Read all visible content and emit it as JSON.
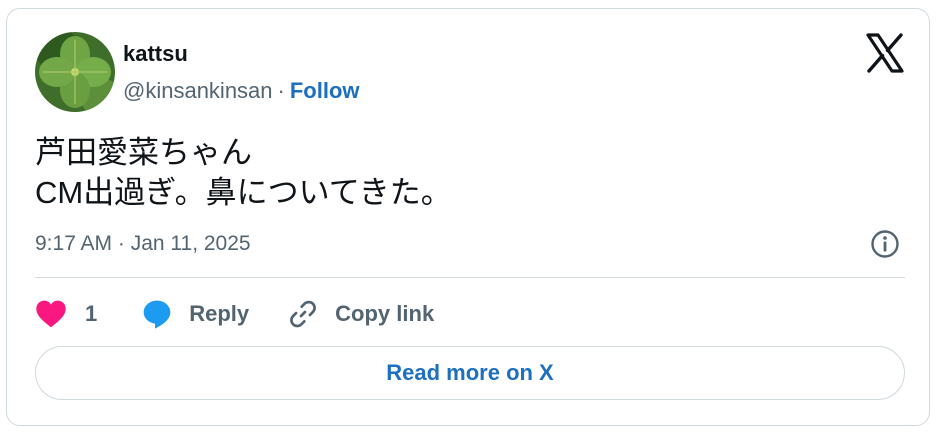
{
  "author": {
    "name": "kattsu",
    "handle": "@kinsankinsan",
    "separator": "·",
    "follow_label": "Follow"
  },
  "platform_logo": "x-logo-icon",
  "tweet": {
    "lines": [
      "芦田愛菜ちゃん",
      "CM出過ぎ。鼻についてきた。"
    ],
    "timestamp": "9:17 AM · Jan 11, 2025"
  },
  "actions": {
    "like_count": "1",
    "reply_label": "Reply",
    "copy_link_label": "Copy link"
  },
  "read_more_label": "Read more on X",
  "icons": {
    "like": "heart-icon",
    "reply": "speech-bubble-icon",
    "copy": "link-icon",
    "info": "info-icon"
  },
  "colors": {
    "heart": "#f91880",
    "reply": "#1d9bf0",
    "link": "#1d6fbf",
    "muted": "#536471",
    "text": "#0f1419",
    "border": "#cfd9de"
  }
}
